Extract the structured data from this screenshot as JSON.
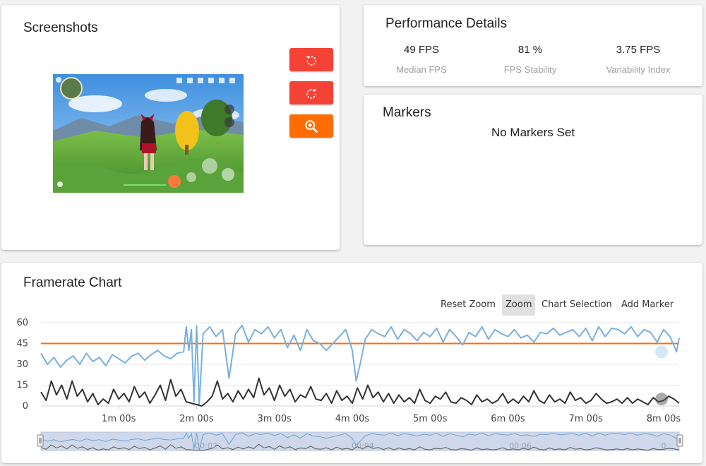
{
  "screenshots": {
    "title": "Screenshots",
    "buttons": [
      {
        "name": "rotate-left-button",
        "icon": "rotate-left-icon",
        "color": "#f44336"
      },
      {
        "name": "rotate-right-button",
        "icon": "rotate-right-icon",
        "color": "#f44336"
      },
      {
        "name": "zoom-in-button",
        "icon": "zoom-in-icon",
        "color": "#ff6d00"
      }
    ]
  },
  "performance": {
    "title": "Performance Details",
    "stats": [
      {
        "value": "49 FPS",
        "label": "Median FPS"
      },
      {
        "value": "81 %",
        "label": "FPS Stability"
      },
      {
        "value": "3.75 FPS",
        "label": "Variability Index"
      }
    ]
  },
  "markers": {
    "title": "Markers",
    "empty_text": "No Markers Set"
  },
  "framerate_chart": {
    "title": "Framerate Chart",
    "toolbar": {
      "reset_zoom": "Reset Zoom",
      "zoom": "Zoom",
      "chart_selection": "Chart Selection",
      "add_marker": "Add Marker",
      "active": "Zoom"
    }
  },
  "chart_data": {
    "type": "line",
    "x_unit": "seconds",
    "xlim": [
      0,
      492
    ],
    "ylim": [
      0,
      60
    ],
    "y_ticks": [
      "0",
      "15",
      "30",
      "45",
      "60"
    ],
    "x_tick_values": [
      60,
      120,
      180,
      240,
      300,
      360,
      420,
      480
    ],
    "x_tick_labels": [
      "1m 00s",
      "2m 00s",
      "3m 00s",
      "4m 00s",
      "5m 00s",
      "6m 00s",
      "7m 00s",
      "8m 00s"
    ],
    "navigator_labels": [
      "00:02",
      "00:04",
      "00:06",
      "0"
    ],
    "reference_line": {
      "value": 45,
      "color": "#ff6d00"
    },
    "series": [
      {
        "color": "#78b0e0",
        "x": [
          0,
          5,
          10,
          15,
          20,
          25,
          30,
          35,
          40,
          45,
          50,
          55,
          60,
          65,
          70,
          75,
          80,
          85,
          90,
          95,
          100,
          105,
          110,
          112,
          114,
          116,
          118,
          120,
          122,
          125,
          130,
          135,
          140,
          145,
          150,
          155,
          160,
          165,
          170,
          175,
          180,
          185,
          190,
          195,
          200,
          205,
          210,
          215,
          220,
          235,
          240,
          243,
          246,
          250,
          255,
          260,
          265,
          270,
          275,
          280,
          285,
          290,
          295,
          300,
          305,
          310,
          315,
          320,
          325,
          330,
          335,
          340,
          345,
          350,
          355,
          360,
          365,
          370,
          375,
          380,
          385,
          390,
          395,
          400,
          405,
          410,
          415,
          420,
          425,
          430,
          435,
          440,
          445,
          450,
          455,
          460,
          465,
          470,
          475,
          480,
          485,
          490,
          492
        ],
        "y": [
          38,
          30,
          35,
          28,
          33,
          36,
          30,
          38,
          32,
          35,
          29,
          37,
          34,
          31,
          36,
          38,
          33,
          37,
          40,
          36,
          34,
          38,
          39,
          57,
          40,
          55,
          3,
          58,
          1,
          52,
          57,
          50,
          55,
          20,
          52,
          58,
          46,
          55,
          52,
          57,
          49,
          55,
          42,
          51,
          40,
          55,
          47,
          45,
          40,
          55,
          40,
          18,
          30,
          48,
          55,
          52,
          50,
          57,
          48,
          55,
          52,
          47,
          53,
          50,
          56,
          46,
          55,
          50,
          44,
          53,
          50,
          57,
          48,
          55,
          52,
          50,
          55,
          49,
          51,
          46,
          53,
          52,
          56,
          51,
          53,
          55,
          50,
          56,
          47,
          57,
          50,
          56,
          55,
          52,
          57,
          50,
          55,
          53,
          46,
          55,
          50,
          39,
          49
        ]
      },
      {
        "color": "#333333",
        "x": [
          0,
          4,
          8,
          12,
          16,
          20,
          24,
          28,
          32,
          36,
          40,
          44,
          48,
          52,
          56,
          60,
          64,
          68,
          72,
          76,
          80,
          84,
          88,
          92,
          96,
          100,
          104,
          108,
          112,
          116,
          120,
          124,
          128,
          132,
          136,
          140,
          144,
          148,
          152,
          156,
          160,
          164,
          168,
          172,
          176,
          180,
          184,
          188,
          192,
          196,
          200,
          204,
          208,
          212,
          216,
          220,
          224,
          228,
          232,
          236,
          240,
          244,
          248,
          252,
          256,
          260,
          264,
          268,
          272,
          276,
          280,
          284,
          288,
          292,
          296,
          300,
          304,
          308,
          312,
          316,
          320,
          324,
          328,
          332,
          336,
          340,
          344,
          348,
          352,
          356,
          360,
          364,
          368,
          372,
          376,
          380,
          384,
          388,
          392,
          396,
          400,
          404,
          408,
          412,
          416,
          420,
          424,
          428,
          432,
          436,
          440,
          444,
          448,
          452,
          456,
          460,
          464,
          468,
          472,
          476,
          480,
          484,
          488,
          492
        ],
        "y": [
          10,
          4,
          18,
          8,
          15,
          5,
          18,
          7,
          12,
          3,
          9,
          1,
          5,
          2,
          12,
          5,
          9,
          3,
          14,
          6,
          10,
          2,
          8,
          15,
          4,
          19,
          7,
          12,
          3,
          2,
          1,
          0,
          3,
          7,
          18,
          5,
          9,
          3,
          11,
          5,
          12,
          6,
          20,
          8,
          13,
          4,
          15,
          7,
          12,
          3,
          8,
          6,
          14,
          5,
          4,
          9,
          2,
          11,
          4,
          7,
          2,
          13,
          5,
          15,
          6,
          10,
          3,
          9,
          2,
          8,
          3,
          6,
          2,
          12,
          4,
          2,
          7,
          5,
          10,
          3,
          2,
          6,
          4,
          1,
          8,
          3,
          5,
          2,
          4,
          9,
          2,
          5,
          2,
          7,
          3,
          11,
          4,
          2,
          8,
          3,
          5,
          2,
          10,
          4,
          6,
          2,
          4,
          9,
          5,
          2,
          3,
          5,
          2,
          6,
          2,
          5,
          3,
          1,
          6,
          3,
          4,
          7,
          5,
          2
        ]
      }
    ],
    "grid": true
  }
}
